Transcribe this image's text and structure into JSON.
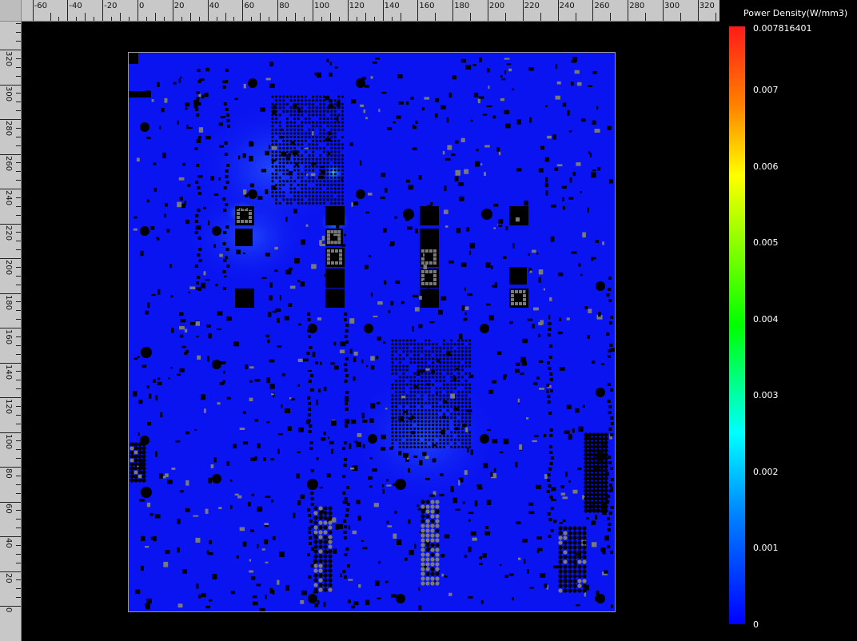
{
  "legend": {
    "title": "Power Density(W/mm3)",
    "max_value": "0.007816401",
    "ticks": [
      "0.007",
      "0.006",
      "0.005",
      "0.004",
      "0.003",
      "0.002",
      "0.001",
      "0"
    ]
  },
  "ruler_top": {
    "labels": [
      "-60",
      "-40",
      "-20",
      "0",
      "20",
      "40",
      "60",
      "80",
      "100",
      "120",
      "140",
      "160",
      "180",
      "200",
      "220",
      "240",
      "260",
      "280",
      "300",
      "320"
    ]
  },
  "ruler_left": {
    "labels": [
      "320",
      "300",
      "280",
      "260",
      "240",
      "220",
      "200",
      "180",
      "160",
      "140",
      "120",
      "100",
      "80",
      "60",
      "40",
      "20",
      "0"
    ]
  },
  "colors": {
    "background": "#000000",
    "board": "#0a14f0",
    "pad_gray": "#7a7a7a",
    "component_black": "#000000",
    "hotspot": "#3ad0ff"
  }
}
